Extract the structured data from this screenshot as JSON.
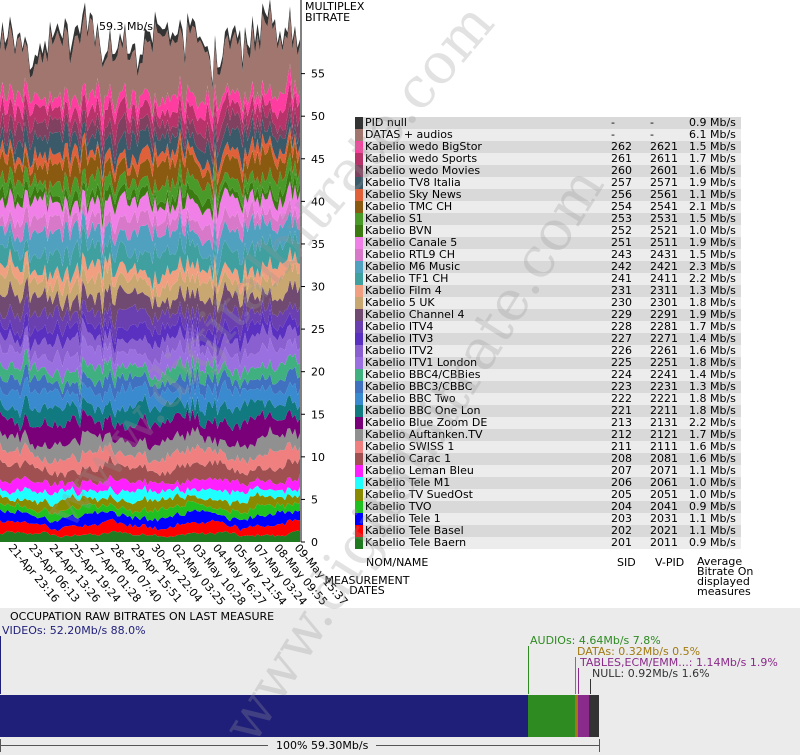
{
  "chart_data": {
    "type": "area",
    "title": "59.3 Mb/s",
    "ylabel": "MULTIPLEX BITRATE",
    "xlabel": "MEASUREMENT DATES",
    "ylim": [
      0,
      59.3
    ],
    "y_ticks": [
      0,
      5,
      10,
      15,
      20,
      25,
      30,
      35,
      40,
      45,
      50,
      55
    ],
    "x_ticks": [
      "21-Apr 23:16",
      "23-Apr 06:13",
      "24-Apr 13:26",
      "25-Apr 19:24",
      "27-Apr 01:28",
      "28-Apr 07:40",
      "29-Apr 15:51",
      "30-Apr 22:04",
      "02-May 03:25",
      "03-May 10:28",
      "04-May 16:27",
      "05-May 21:54",
      "07-May 03:24",
      "08-May 09:55",
      "09-May 15:37"
    ],
    "legend_headers": {
      "name": "NOM/NAME",
      "sid": "SID",
      "vpid": "V-PID",
      "bitrate": "Average Bitrate On displayed measures"
    },
    "series": [
      {
        "name": "PID null",
        "sid": "-",
        "vpid": "-",
        "bitrate": "0.9 Mb/s",
        "value": 0.9,
        "color": "#333333"
      },
      {
        "name": "DATAS + audios",
        "sid": "-",
        "vpid": "-",
        "bitrate": "6.1 Mb/s",
        "value": 6.1,
        "color": "#a0766e"
      },
      {
        "name": "Kabelio wedo BigStor",
        "sid": "262",
        "vpid": "2621",
        "bitrate": "1.5 Mb/s",
        "value": 1.5,
        "color": "#ff3ca0"
      },
      {
        "name": "Kabelio wedo Sports",
        "sid": "261",
        "vpid": "2611",
        "bitrate": "1.7 Mb/s",
        "value": 1.7,
        "color": "#b8336a"
      },
      {
        "name": "Kabelio wedo Movies",
        "sid": "260",
        "vpid": "2601",
        "bitrate": "1.6 Mb/s",
        "value": 1.6,
        "color": "#80405f"
      },
      {
        "name": "Kabelio TV8 Italia",
        "sid": "257",
        "vpid": "2571",
        "bitrate": "1.9 Mb/s",
        "value": 1.9,
        "color": "#3a5a6a"
      },
      {
        "name": "Kabelio Sky News",
        "sid": "256",
        "vpid": "2561",
        "bitrate": "1.1 Mb/s",
        "value": 1.1,
        "color": "#e0603a"
      },
      {
        "name": "Kabelio TMC CH",
        "sid": "254",
        "vpid": "2541",
        "bitrate": "2.1 Mb/s",
        "value": 2.1,
        "color": "#8a5a10"
      },
      {
        "name": "Kabelio S1",
        "sid": "253",
        "vpid": "2531",
        "bitrate": "1.5 Mb/s",
        "value": 1.5,
        "color": "#4a9a2a"
      },
      {
        "name": "Kabelio BVN",
        "sid": "252",
        "vpid": "2521",
        "bitrate": "1.0 Mb/s",
        "value": 1.0,
        "color": "#3a7a10"
      },
      {
        "name": "Kabelio Canale 5",
        "sid": "251",
        "vpid": "2511",
        "bitrate": "1.9 Mb/s",
        "value": 1.9,
        "color": "#f080e8"
      },
      {
        "name": "Kabelio RTL9 CH",
        "sid": "243",
        "vpid": "2431",
        "bitrate": "1.5 Mb/s",
        "value": 1.5,
        "color": "#d878c8"
      },
      {
        "name": "Kabelio M6 Music",
        "sid": "242",
        "vpid": "2421",
        "bitrate": "2.3 Mb/s",
        "value": 2.3,
        "color": "#50a0c0"
      },
      {
        "name": "Kabelio TF1 CH",
        "sid": "241",
        "vpid": "2411",
        "bitrate": "2.2 Mb/s",
        "value": 2.2,
        "color": "#40a0a0"
      },
      {
        "name": "Kabelio Film 4",
        "sid": "231",
        "vpid": "2311",
        "bitrate": "1.3 Mb/s",
        "value": 1.3,
        "color": "#f0a080"
      },
      {
        "name": "Kabelio 5 UK",
        "sid": "230",
        "vpid": "2301",
        "bitrate": "1.8 Mb/s",
        "value": 1.8,
        "color": "#c8a870"
      },
      {
        "name": "Kabelio Channel 4",
        "sid": "229",
        "vpid": "2291",
        "bitrate": "1.9 Mb/s",
        "value": 1.9,
        "color": "#704a70"
      },
      {
        "name": "Kabelio ITV4",
        "sid": "228",
        "vpid": "2281",
        "bitrate": "1.7 Mb/s",
        "value": 1.7,
        "color": "#6a40b0"
      },
      {
        "name": "Kabelio ITV3",
        "sid": "227",
        "vpid": "2271",
        "bitrate": "1.4 Mb/s",
        "value": 1.4,
        "color": "#5a30c0"
      },
      {
        "name": "Kabelio ITV2",
        "sid": "226",
        "vpid": "2261",
        "bitrate": "1.6 Mb/s",
        "value": 1.6,
        "color": "#8a60d0"
      },
      {
        "name": "Kabelio ITV1 London",
        "sid": "225",
        "vpid": "2251",
        "bitrate": "1.8 Mb/s",
        "value": 1.8,
        "color": "#9a70e0"
      },
      {
        "name": "Kabelio BBC4/CBBies",
        "sid": "224",
        "vpid": "2241",
        "bitrate": "1.4 Mb/s",
        "value": 1.4,
        "color": "#40b080"
      },
      {
        "name": "Kabelio BBC3/CBBC",
        "sid": "223",
        "vpid": "2231",
        "bitrate": "1.3 Mb/s",
        "value": 1.3,
        "color": "#4070c0"
      },
      {
        "name": "Kabelio BBC Two",
        "sid": "222",
        "vpid": "2221",
        "bitrate": "1.8 Mb/s",
        "value": 1.8,
        "color": "#3a8ad0"
      },
      {
        "name": "Kabelio BBC One Lon",
        "sid": "221",
        "vpid": "2211",
        "bitrate": "1.8 Mb/s",
        "value": 1.8,
        "color": "#107a80"
      },
      {
        "name": "Kabelio Blue Zoom DE",
        "sid": "213",
        "vpid": "2131",
        "bitrate": "2.2 Mb/s",
        "value": 2.2,
        "color": "#7a007a"
      },
      {
        "name": "Kabelio Auftanken.TV",
        "sid": "212",
        "vpid": "2121",
        "bitrate": "1.7 Mb/s",
        "value": 1.7,
        "color": "#909090"
      },
      {
        "name": "Kabelio SWISS 1",
        "sid": "211",
        "vpid": "2111",
        "bitrate": "1.6 Mb/s",
        "value": 1.6,
        "color": "#f08080"
      },
      {
        "name": "Kabelio Carac 1",
        "sid": "208",
        "vpid": "2081",
        "bitrate": "1.6 Mb/s",
        "value": 1.6,
        "color": "#a05050"
      },
      {
        "name": "Kabelio Leman Bleu",
        "sid": "207",
        "vpid": "2071",
        "bitrate": "1.1 Mb/s",
        "value": 1.1,
        "color": "#ff20ff"
      },
      {
        "name": "Kabelio Tele M1",
        "sid": "206",
        "vpid": "2061",
        "bitrate": "1.0 Mb/s",
        "value": 1.0,
        "color": "#20ffff"
      },
      {
        "name": "Kabelio TV SuedOst",
        "sid": "205",
        "vpid": "2051",
        "bitrate": "1.0 Mb/s",
        "value": 1.0,
        "color": "#8a8a00"
      },
      {
        "name": "Kabelio TVO",
        "sid": "204",
        "vpid": "2041",
        "bitrate": "0.9 Mb/s",
        "value": 0.9,
        "color": "#20c020"
      },
      {
        "name": "Kabelio Tele 1",
        "sid": "203",
        "vpid": "2031",
        "bitrate": "1.1 Mb/s",
        "value": 1.1,
        "color": "#0000ff"
      },
      {
        "name": "Kabelio Tele Basel",
        "sid": "202",
        "vpid": "2021",
        "bitrate": "1.1 Mb/s",
        "value": 1.1,
        "color": "#ff0000"
      },
      {
        "name": "Kabelio Tele Baern",
        "sid": "201",
        "vpid": "2011",
        "bitrate": "0.9 Mb/s",
        "value": 0.9,
        "color": "#207a20"
      }
    ]
  },
  "occupation": {
    "title": "OCCUPATION RAW BITRATES ON LAST MEASURE",
    "videos": {
      "label": "VIDEOs: 52.20Mb/s  88.0%",
      "value": 52.2,
      "percent": 88.0,
      "color": "#1f1f7a"
    },
    "audios": {
      "label": "AUDIOs: 4.64Mb/s  7.8%",
      "value": 4.64,
      "percent": 7.8,
      "color": "#2e8b22"
    },
    "datas": {
      "label": "DATAs: 0.32Mb/s  0.5%",
      "value": 0.32,
      "percent": 0.5,
      "color": "#a07a10"
    },
    "tables": {
      "label": "TABLES,ECM/EMM...: 1.14Mb/s  1.9%",
      "value": 1.14,
      "percent": 1.9,
      "color": "#8a2a8a"
    },
    "null": {
      "label": "NULL: 0.92Mb/s  1.6%",
      "value": 0.92,
      "percent": 1.6,
      "color": "#333333"
    },
    "total": "100%  59.30Mb/s"
  },
  "watermark": "www.digitalbitrate.com"
}
